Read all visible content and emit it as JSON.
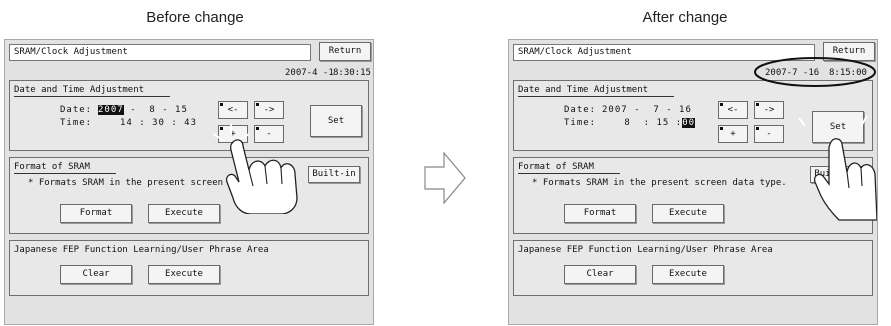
{
  "captions": {
    "before": "Before change",
    "after": "After change"
  },
  "before": {
    "window_title": "SRAM/Clock Adjustment",
    "return_label": "Return",
    "clock_date": "2007-4 -1",
    "clock_time": "8:30:15",
    "datetime": {
      "group_title": "Date and Time Adjustment",
      "date_label": "Date:",
      "year": "2007",
      "date_rest": " -  8 - 15",
      "time_label": "Time:",
      "time_value": "14 : 30 : 43",
      "left_label": "<-",
      "right_label": "->",
      "plus_label": "+",
      "minus_label": "-",
      "set_label": "Set"
    },
    "sram": {
      "group_title": "Format of SRAM",
      "desc": "* Formats SRAM in the present screen data type.",
      "builtin_label": "Built-in",
      "format_label": "Format",
      "execute_label": "Execute"
    },
    "fep": {
      "group_title": "Japanese FEP Function Learning/User Phrase Area",
      "clear_label": "Clear",
      "execute_label": "Execute"
    }
  },
  "after": {
    "window_title": "SRAM/Clock Adjustment",
    "return_label": "Return",
    "clock_date": "2007-7 -16",
    "clock_time": "8:15:00",
    "datetime": {
      "group_title": "Date and Time Adjustment",
      "date_label": "Date:",
      "date_value": "2007 -  7 - 16",
      "time_label": "Time:",
      "time_rest": " 8  : 15 :",
      "seconds": "00",
      "left_label": "<-",
      "right_label": "->",
      "plus_label": "+",
      "minus_label": "-",
      "set_label": "Set"
    },
    "sram": {
      "group_title": "Format of SRAM",
      "desc": "* Formats SRAM in the present screen data type.",
      "builtin_label": "Built-in",
      "format_label": "Format",
      "execute_label": "Execute"
    },
    "fep": {
      "group_title": "Japanese FEP Function Learning/User Phrase Area",
      "clear_label": "Clear",
      "execute_label": "Execute"
    }
  },
  "colors": {
    "panel": "#e2e2e2",
    "border": "#6a6a6a",
    "highlight": "#111111"
  },
  "icons": {
    "hand": "pointing-hand-icon",
    "arrow": "right-arrow-icon"
  }
}
